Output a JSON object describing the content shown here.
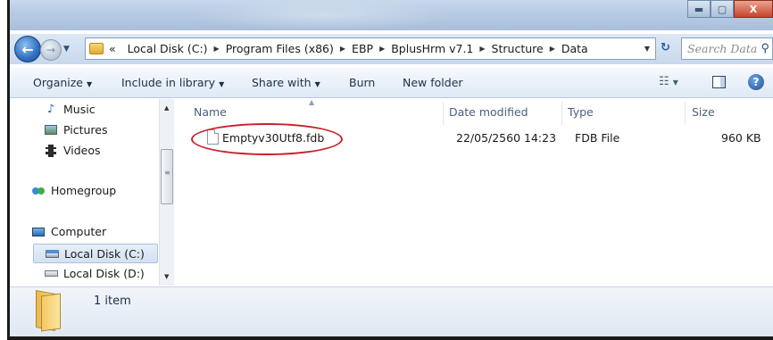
{
  "window": {
    "controls": {
      "minimize": "▬",
      "maximize": "▢",
      "close": "X"
    }
  },
  "address": {
    "prefix": "«",
    "crumbs": [
      "Local Disk (C:)",
      "Program Files (x86)",
      "EBP",
      "BplusHrm v7.1",
      "Structure",
      "Data"
    ],
    "search_placeholder": "Search Data"
  },
  "toolbar": {
    "organize": "Organize",
    "include_in_library": "Include in library",
    "share_with": "Share with",
    "burn": "Burn",
    "new_folder": "New folder"
  },
  "nav_pane": {
    "items": [
      {
        "label": "Music",
        "icon": "music-icon"
      },
      {
        "label": "Pictures",
        "icon": "pictures-icon"
      },
      {
        "label": "Videos",
        "icon": "videos-icon"
      },
      {
        "label": "Homegroup",
        "icon": "homegroup-icon"
      },
      {
        "label": "Computer",
        "icon": "computer-icon"
      },
      {
        "label": "Local Disk (C:)",
        "icon": "drive-icon",
        "selected": true
      },
      {
        "label": "Local Disk (D:)",
        "icon": "drive-icon"
      }
    ]
  },
  "file_list": {
    "columns": [
      "Name",
      "Date modified",
      "Type",
      "Size"
    ],
    "rows": [
      {
        "name": "Emptyv30Utf8.fdb",
        "date_modified": "22/05/2560 14:23",
        "type": "FDB File",
        "size": "960 KB"
      }
    ]
  },
  "status_bar": {
    "text": "1 item"
  },
  "colors": {
    "highlight_ring": "#c8202a",
    "title_bar": "#b7cbe3",
    "close_button": "#c7442a"
  }
}
